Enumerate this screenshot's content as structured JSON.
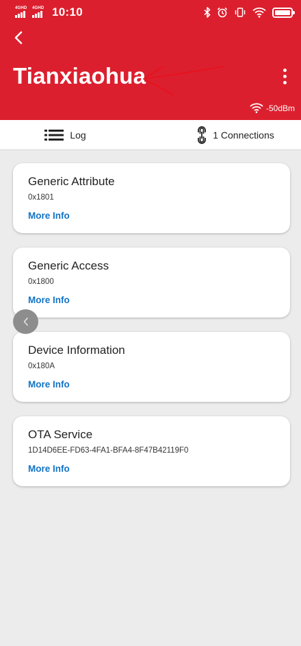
{
  "status_bar": {
    "network_1": "4GHD",
    "network_2": "4GHD",
    "time": "10:10"
  },
  "header": {
    "title": "Tianxiaohua",
    "rssi": "-50dBm",
    "background_color": "#dc1f2e"
  },
  "tabs": [
    {
      "label": "Log",
      "icon": "list-icon"
    },
    {
      "label": "1 Connections",
      "icon": "link-icon"
    }
  ],
  "services": [
    {
      "name": "Generic Attribute",
      "uuid": "0x1801",
      "action": "More Info"
    },
    {
      "name": "Generic Access",
      "uuid": "0x1800",
      "action": "More Info"
    },
    {
      "name": "Device Information",
      "uuid": "0x180A",
      "action": "More Info"
    },
    {
      "name": "OTA Service",
      "uuid": "1D14D6EE-FD63-4FA1-BFA4-8F47B42119F0",
      "action": "More Info"
    }
  ],
  "colors": {
    "accent": "#1273c5",
    "page_background": "#ececec",
    "annotation": "#e8111b"
  }
}
